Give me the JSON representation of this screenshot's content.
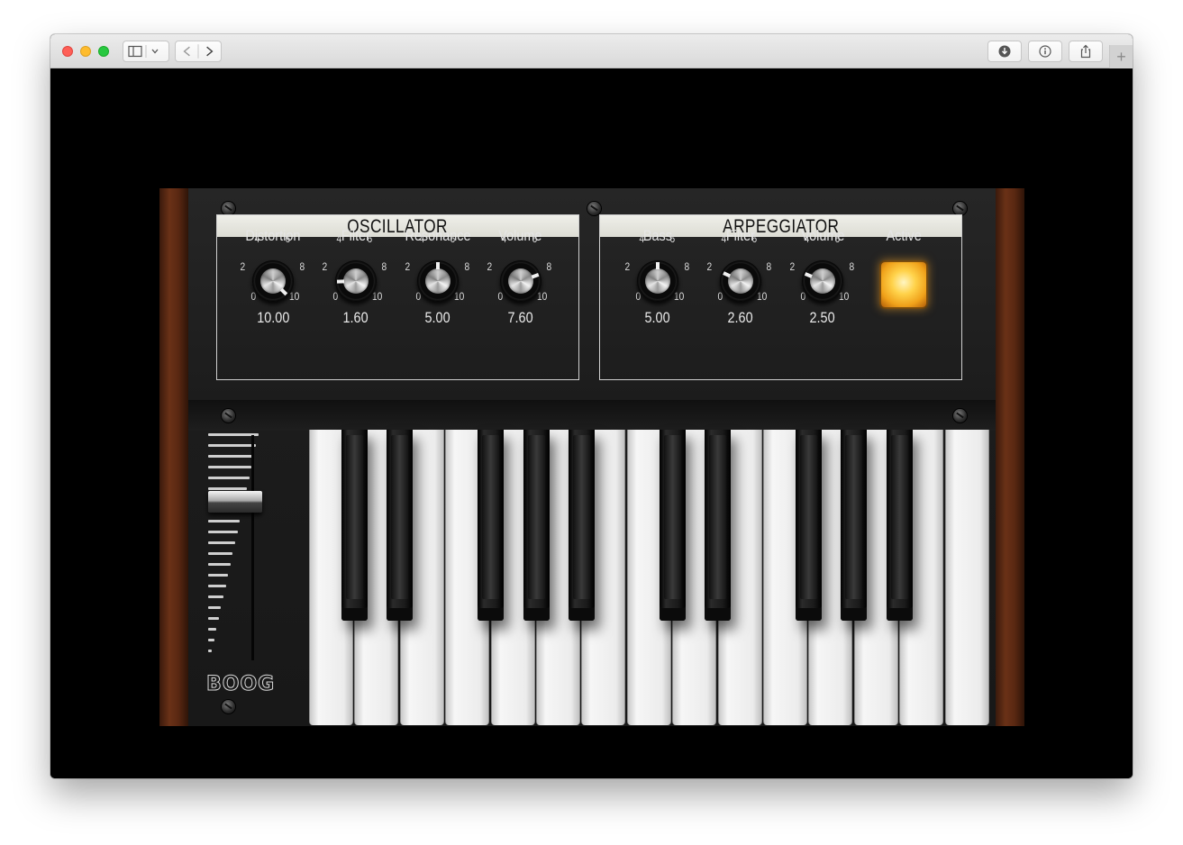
{
  "browser": {
    "buttons": {
      "sidebar": "sidebar-icon",
      "back": "chevron-left-icon",
      "forward": "chevron-right-icon",
      "download": "download-icon",
      "info": "info-icon",
      "share": "share-icon",
      "new_tab": "+"
    }
  },
  "oscillator": {
    "title": "OSCILLATOR",
    "knobs": [
      {
        "label": "Distortion",
        "value": "10.00",
        "level": 1.0
      },
      {
        "label": "Filter",
        "value": "1.60",
        "level": 0.16
      },
      {
        "label": "Resonance",
        "value": "5.00",
        "level": 0.5
      },
      {
        "label": "Volume",
        "value": "7.60",
        "level": 0.76
      }
    ]
  },
  "arpeggiator": {
    "title": "ARPEGGIATOR",
    "knobs": [
      {
        "label": "Bass",
        "value": "5.00",
        "level": 0.5
      },
      {
        "label": "Filter",
        "value": "2.60",
        "level": 0.26
      },
      {
        "label": "Volume",
        "value": "2.50",
        "level": 0.25
      }
    ],
    "active_label": "Active",
    "active_on": true
  },
  "scale_ticks": [
    "0",
    "2",
    "4",
    "6",
    "8",
    "10"
  ],
  "logo": "BOOG",
  "pitch_slider_level": 0.72,
  "keyboard": {
    "white_keys": 15,
    "black_keys": 10
  },
  "colors": {
    "active_light": "#ffc83a",
    "wood": "#5a2812",
    "panel_header": "#e6e6e0"
  }
}
